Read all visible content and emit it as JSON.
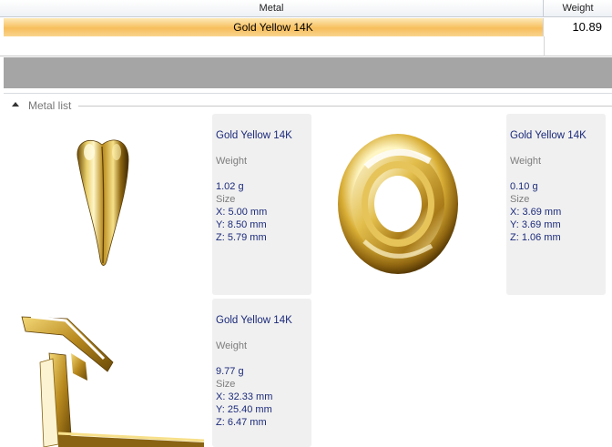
{
  "grid": {
    "columns": {
      "metal": "Metal",
      "weight": "Weight"
    },
    "rows": [
      {
        "metal": "Gold Yellow 14K",
        "weight": "10.89",
        "selected": true
      }
    ]
  },
  "group": {
    "title": "Metal list",
    "icon": "collapse-triangle-icon"
  },
  "cards": [
    {
      "image": "tooth-pendant-3d-render",
      "metal": "Gold Yellow 14K",
      "weight_label": "Weight",
      "weight": "1.02 g",
      "size_label": "Size",
      "x": "X: 5.00 mm",
      "y": "Y: 8.50 mm",
      "z": "Z: 5.79 mm"
    },
    {
      "image": "ring-3d-render",
      "metal": "Gold Yellow 14K",
      "weight_label": "Weight",
      "weight": "0.10 g",
      "size_label": "Size",
      "x": "X: 3.69 mm",
      "y": "Y: 3.69 mm",
      "z": "Z: 1.06 mm"
    },
    {
      "image": "treadmill-3d-render",
      "metal": "Gold Yellow 14K",
      "weight_label": "Weight",
      "weight": "9.77 g",
      "size_label": "Size",
      "x": "X: 32.33 mm",
      "y": "Y: 25.40 mm",
      "z": "Z: 6.47 mm"
    }
  ],
  "colors": {
    "selection": "#f7be5c",
    "gold": "#d4a928",
    "info_text": "#1b2a7a"
  }
}
